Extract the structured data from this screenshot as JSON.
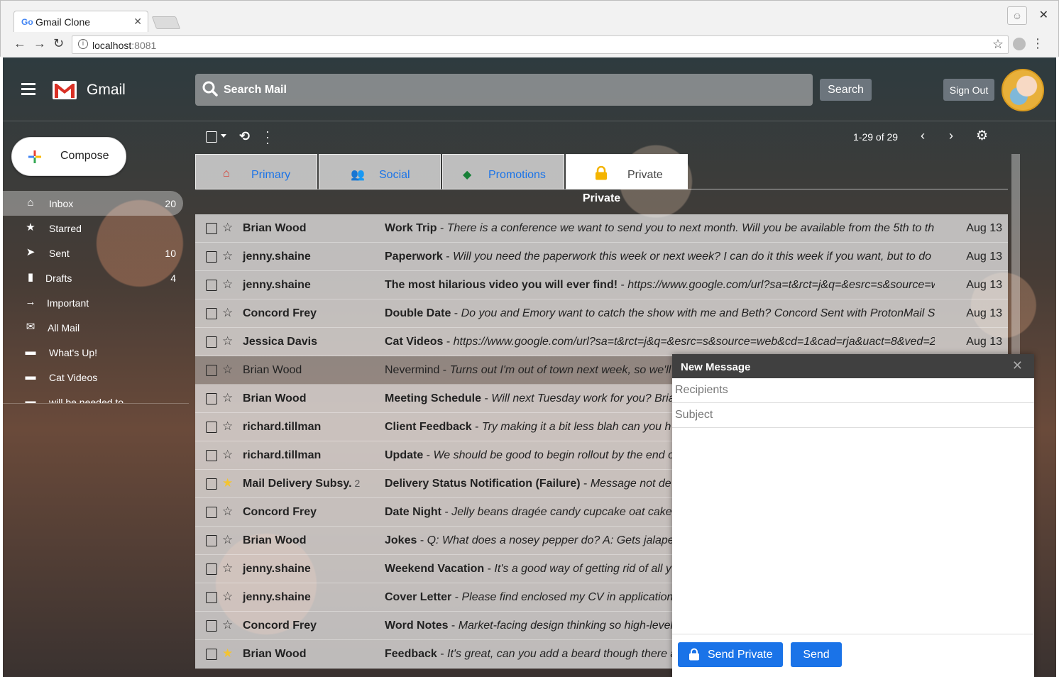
{
  "browser": {
    "tab_title": "Gmail Clone",
    "tab_favicon": "Go",
    "url_host": "localhost",
    "url_port": ":8081"
  },
  "header": {
    "app_name": "Gmail",
    "search_placeholder": "Search Mail",
    "search_button": "Search",
    "signout_button": "Sign Out"
  },
  "compose_button": "Compose",
  "sidebar": {
    "items": [
      {
        "label": "Inbox",
        "count": "20",
        "icon": "inbox-icon",
        "active": true
      },
      {
        "label": "Starred",
        "count": "",
        "icon": "star-icon"
      },
      {
        "label": "Sent",
        "count": "10",
        "icon": "send-icon"
      },
      {
        "label": "Drafts",
        "count": "4",
        "icon": "file-icon"
      },
      {
        "label": "Important",
        "count": "",
        "icon": "arrow-right-icon"
      },
      {
        "label": "All Mail",
        "count": "",
        "icon": "envelope-icon"
      },
      {
        "label": "What's Up!",
        "count": "",
        "icon": "folder-icon"
      },
      {
        "label": "Cat Videos",
        "count": "",
        "icon": "folder-icon"
      },
      {
        "label": "will be needed to",
        "count": "",
        "icon": "folder-icon"
      }
    ]
  },
  "toolbar": {
    "pager": "1-29 of 29"
  },
  "tabs": [
    {
      "label": "Primary",
      "icon": "inbox-icon",
      "color": "#d93025"
    },
    {
      "label": "Social",
      "icon": "users-icon",
      "color": "#1a73e8"
    },
    {
      "label": "Promotions",
      "icon": "tag-icon",
      "color": "#188038"
    },
    {
      "label": "Private",
      "icon": "lock-icon",
      "color": "#f4b400",
      "active": true
    }
  ],
  "list_title": "Private",
  "emails": [
    {
      "sender": "Brian Wood",
      "thread": "",
      "subject": "Work Trip",
      "preview": "There is a conference we want to send you to next month. Will you be available from the 5th to th",
      "date": "Aug 13",
      "starred": false,
      "read": false
    },
    {
      "sender": "jenny.shaine",
      "thread": "",
      "subject": "Paperwork",
      "preview": "Will you need the paperwork this week or next week? I can do it this week if you want, but to do",
      "date": "Aug 13",
      "starred": false,
      "read": false
    },
    {
      "sender": "jenny.shaine",
      "thread": "",
      "subject": "The most hilarious video you will ever find!",
      "preview": "https://www.google.com/url?sa=t&rct=j&q=&esrc=s&source=w",
      "date": "Aug 13",
      "starred": false,
      "read": false
    },
    {
      "sender": "Concord Frey",
      "thread": "",
      "subject": "Double Date",
      "preview": "Do you and Emory want to catch the show with me and Beth? Concord Sent with ProtonMail S",
      "date": "Aug 13",
      "starred": false,
      "read": false
    },
    {
      "sender": "Jessica Davis",
      "thread": "",
      "subject": "Cat Videos",
      "preview": "https://www.google.com/url?sa=t&rct=j&q=&esrc=s&source=web&cd=1&cad=rja&uact=8&ved=2",
      "date": "Aug 13",
      "starred": false,
      "read": false
    },
    {
      "sender": "Brian Wood",
      "thread": "",
      "subject": "Nevermind",
      "preview": "Turns out I'm out of town next week, so we'll",
      "date": "",
      "starred": false,
      "read": true
    },
    {
      "sender": "Brian Wood",
      "thread": "",
      "subject": "Meeting Schedule",
      "preview": "Will next Tuesday work for you? Bria",
      "date": "",
      "starred": false,
      "read": false
    },
    {
      "sender": "richard.tillman",
      "thread": "",
      "subject": "Client Feedback",
      "preview": "Try making it a bit less blah can you h",
      "date": "",
      "starred": false,
      "read": false
    },
    {
      "sender": "richard.tillman",
      "thread": "",
      "subject": "Update",
      "preview": "We should be good to begin rollout by the end o",
      "date": "",
      "starred": false,
      "read": false
    },
    {
      "sender": "Mail Delivery Subsy.",
      "thread": "2",
      "subject": "Delivery Status Notification (Failure)",
      "preview": "Message not de",
      "date": "",
      "starred": true,
      "read": false
    },
    {
      "sender": "Concord Frey",
      "thread": "",
      "subject": "Date Night",
      "preview": "Jelly beans dragée candy cupcake oat cake",
      "date": "",
      "starred": false,
      "read": false
    },
    {
      "sender": "Brian Wood",
      "thread": "",
      "subject": "Jokes",
      "preview": "Q: What does a nosey pepper do? A: Gets jalape",
      "date": "",
      "starred": false,
      "read": false
    },
    {
      "sender": "jenny.shaine",
      "thread": "",
      "subject": "Weekend Vacation",
      "preview": "It's a good way of getting rid of all y",
      "date": "",
      "starred": false,
      "read": false
    },
    {
      "sender": "jenny.shaine",
      "thread": "",
      "subject": "Cover Letter",
      "preview": "Please find enclosed my CV in application",
      "date": "",
      "starred": false,
      "read": false
    },
    {
      "sender": "Concord Frey",
      "thread": "",
      "subject": "Word Notes",
      "preview": "Market-facing design thinking so high-level",
      "date": "",
      "starred": false,
      "read": false
    },
    {
      "sender": "Brian Wood",
      "thread": "",
      "subject": "Feedback",
      "preview": "It's great, can you add a beard though there a",
      "date": "",
      "starred": true,
      "read": false
    }
  ],
  "compose": {
    "title": "New Message",
    "recipients_placeholder": "Recipients",
    "subject_placeholder": "Subject",
    "send_private": "Send Private",
    "send": "Send"
  }
}
